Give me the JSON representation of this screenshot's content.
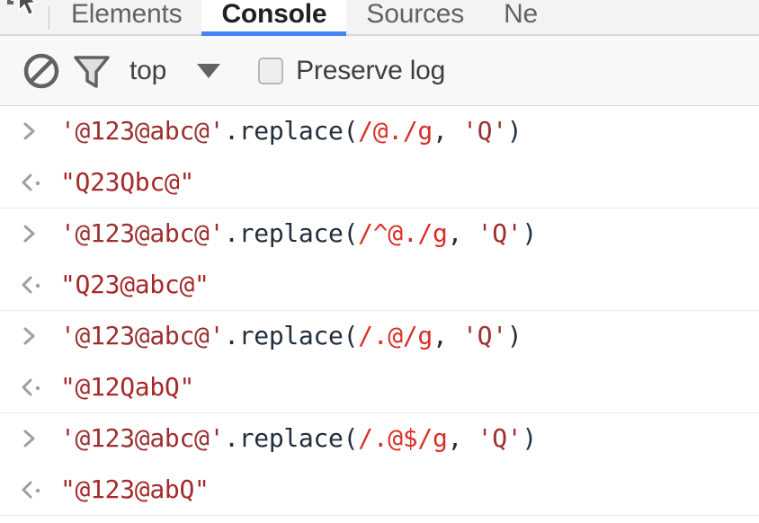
{
  "window": {
    "title": "DevTools Console"
  },
  "tabbar": {
    "inspect_icon": "inspect-element-icon",
    "tabs": [
      {
        "label": "Elements",
        "active": false
      },
      {
        "label": "Console",
        "active": true
      },
      {
        "label": "Sources",
        "active": false
      },
      {
        "label": "Ne",
        "active": false
      }
    ],
    "active_tab": "Console",
    "active_underline_color": "#4285f4"
  },
  "toolbar": {
    "clear_console_icon": "clear-console-icon",
    "filter_icon": "filter-funnel-icon",
    "context_value": "top",
    "context_caret_icon": "chevron-down-icon",
    "preserve_log_label": "Preserve log",
    "preserve_log_checked": false
  },
  "console": {
    "input_prompt_glyph": ">",
    "output_prompt_glyph": "<",
    "entries": [
      {
        "input": {
          "string_literal": "'@123@abc@'",
          "method": ".replace(",
          "regex": "/@./g",
          "separator": ", ",
          "replacement": "'Q'",
          "close": ")"
        },
        "output": "\"Q23Qbc@\""
      },
      {
        "input": {
          "string_literal": "'@123@abc@'",
          "method": ".replace(",
          "regex": "/^@./g",
          "separator": ", ",
          "replacement": "'Q'",
          "close": ")"
        },
        "output": "\"Q23@abc@\""
      },
      {
        "input": {
          "string_literal": "'@123@abc@'",
          "method": ".replace(",
          "regex": "/.@/g",
          "separator": ", ",
          "replacement": "'Q'",
          "close": ")"
        },
        "output": "\"@12QabQ\""
      },
      {
        "input": {
          "string_literal": "'@123@abc@'",
          "method": ".replace(",
          "regex": "/.@$/g",
          "separator": ", ",
          "replacement": "'Q'",
          "close": ")"
        },
        "output": "\"@123@abQ\""
      }
    ]
  },
  "colors": {
    "string_token": "#9c2f2f",
    "regex_token": "#d93025",
    "plain_token": "#222e3c",
    "result_token": "#a52a2a",
    "tab_accent": "#4285f4"
  }
}
